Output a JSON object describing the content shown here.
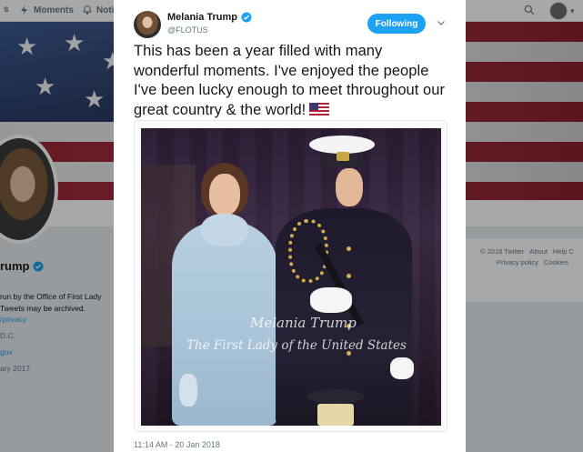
{
  "topnav": {
    "moments_label": "Moments",
    "notifications_label": "Notifi"
  },
  "profile": {
    "name_fragment": "rump",
    "bio_lines": [
      "run by the Office of First Lady",
      "Tweets may be archived."
    ],
    "bio_link": "/privacy",
    "location_fragment": "D.C.",
    "website_fragment": "gov",
    "joined_fragment": "ary 2017"
  },
  "footer_links": {
    "copyright": "© 2018 Twitter",
    "about": "About",
    "help": "Help C",
    "privacy": "Privacy policy",
    "cookies": "Cookies"
  },
  "tweet": {
    "author_name": "Melania Trump",
    "author_handle": "@FLOTUS",
    "follow_label": "Following",
    "text": "This has been a year filled with many wonderful moments. I've enjoyed the people I've been lucky enough to meet throughout our great country & the world!",
    "photo_caption_line1": "Melania Trump",
    "photo_caption_line2": "The First Lady of the United States",
    "timestamp": "11:14 AM - 20 Jan 2018"
  },
  "colors": {
    "accent": "#1da1f2",
    "text_primary": "#14171a",
    "text_secondary": "#657786",
    "overlay": "rgba(0,0,0,0.34)"
  },
  "icons": {
    "moments": "lightning-icon",
    "notifications": "bell-icon",
    "search": "search-icon",
    "verified": "verified-badge-icon",
    "menu": "chevron-down-icon",
    "flag": "us-flag-emoji"
  }
}
